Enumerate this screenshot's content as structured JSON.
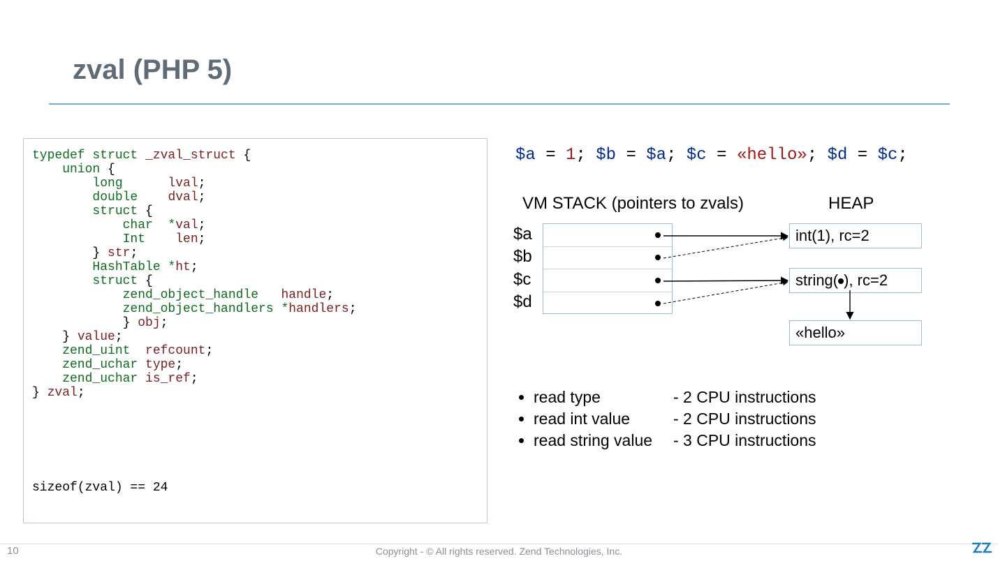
{
  "title": "zval (PHP 5)",
  "code": {
    "l1a": "typedef struct ",
    "l1b": "_zval_struct",
    "l1c": " {",
    "l2a": "    union",
    "l2b": " {",
    "l3a": "        long      ",
    "l3b": "lval",
    "l3c": ";",
    "l4a": "        double    ",
    "l4b": "dval",
    "l4c": ";",
    "l5a": "        struct",
    "l5b": " {",
    "l6a": "            char  *",
    "l6b": "val",
    "l6c": ";",
    "l7a": "            Int    ",
    "l7b": "len",
    "l7c": ";",
    "l8a": "        } ",
    "l8b": "str",
    "l8c": ";",
    "l9a": "        HashTable *",
    "l9b": "ht",
    "l9c": ";",
    "l10a": "        struct",
    "l10b": " {",
    "l11a": "            zend_object_handle   ",
    "l11b": "handle",
    "l11c": ";",
    "l12a": "            zend_object_handlers *",
    "l12b": "handlers",
    "l12c": ";",
    "l13a": "            } ",
    "l13b": "obj",
    "l13c": ";",
    "l14a": "    } ",
    "l14b": "value",
    "l14c": ";",
    "l15a": "    zend_uint  ",
    "l15b": "refcount",
    "l15c": ";",
    "l16a": "    zend_uchar ",
    "l16b": "type",
    "l16c": ";",
    "l17a": "    zend_uchar ",
    "l17b": "is_ref",
    "l17c": ";",
    "l18a": "} ",
    "l18b": "zval",
    "l18c": ";"
  },
  "sizeof": "sizeof(zval) == 24",
  "php": {
    "a": "$a",
    "eq1": " = ",
    "one": "1",
    "s1": "; ",
    "b": "$b",
    "eq2": " = ",
    "ar": "$a",
    "s2": "; ",
    "c": "$c",
    "eq3": " = ",
    "hello": "«hello»",
    "s3": "; ",
    "d": "$d",
    "eq4": " = ",
    "cr": "$c",
    "s4": ";"
  },
  "labels": {
    "stack": "VM STACK (pointers to zvals)",
    "heap": "HEAP",
    "va": "$a",
    "vb": "$b",
    "vc": "$c",
    "vd": "$d"
  },
  "heap": {
    "int": "int(1), rc=2",
    "string_pre": "string(",
    "string_post": "), rc=2",
    "hello": "«hello»"
  },
  "bullets": {
    "b1l": "read type",
    "b1r": "- 2 CPU instructions",
    "b2l": "read int value",
    "b2r": "- 2 CPU instructions",
    "b3l": "read string value",
    "b3r": "- 3 CPU instructions"
  },
  "footer": {
    "page": "10",
    "copyright": "Copyright - © All rights reserved. Zend Technologies, Inc."
  }
}
